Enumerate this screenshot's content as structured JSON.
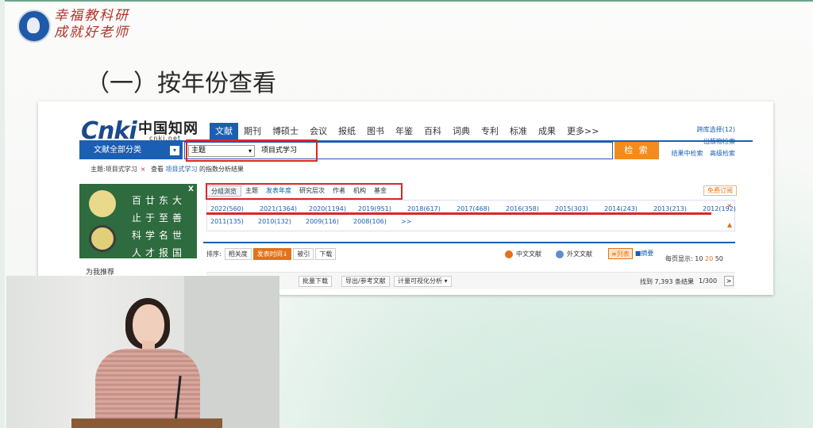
{
  "slide": {
    "logo_line1": "幸福教科研",
    "logo_line2": "成就好老师",
    "title": "（一）按年份查看"
  },
  "cnki": {
    "logo": {
      "cnki": "Cnki",
      "chinese": "中国知网",
      "net": "cnki.net"
    },
    "nav": [
      "文献",
      "期刊",
      "博硕士",
      "会议",
      "报纸",
      "图书",
      "年鉴",
      "百科",
      "词典",
      "专利",
      "标准",
      "成果",
      "更多>>"
    ],
    "right_links": {
      "cross_db": "跨库选择(12)",
      "pub_search": "出版物检索",
      "in_result": "结果中检索",
      "advanced": "高级检索"
    },
    "category_button": "文献全部分类",
    "category_dropdown": "▾",
    "search": {
      "field": "主题",
      "field_arrow": "▾",
      "query": "项目式学习",
      "button": "检 索"
    },
    "breadcrumb": {
      "tag": "主题:项目式学习",
      "close": "×",
      "view_prefix": "查看",
      "view_link": "项目式学习",
      "view_suffix": "的指数分析结果"
    },
    "ad": {
      "close": "X",
      "poem": [
        "百廿东大",
        "止于至善",
        "科学名世",
        "人才报国"
      ]
    },
    "recommend": "为我推荐",
    "group_tabs": [
      "分组浏览",
      "主题",
      "发表年度",
      "研究层次",
      "作者",
      "机构",
      "基金"
    ],
    "subscribe": "免费订阅",
    "years_row1": [
      "2022(560)",
      "2021(1364)",
      "2020(1194)",
      "2019(951)",
      "2018(617)",
      "2017(468)",
      "2016(358)",
      "2015(303)",
      "2014(243)",
      "2013(213)",
      "2012(192)"
    ],
    "years_row2": [
      "2011(135)",
      "2010(132)",
      "2009(116)",
      "2008(106)",
      ">>"
    ],
    "year_panel_close": "×",
    "year_panel_icon": "▲",
    "sort": {
      "label": "排序:",
      "options": [
        "相关度",
        "发表时间↓",
        "被引",
        "下载"
      ]
    },
    "lang": {
      "zh": "中文文献",
      "foreign": "外文文献"
    },
    "view": {
      "list": "≡列表",
      "abstract": "■摘要"
    },
    "per_page": {
      "label": "每页显示:",
      "opt1": "10",
      "opt2": "20",
      "opt3": "50"
    },
    "actions": [
      "批量下载",
      "导出/参考文献",
      "计量可视化分析 ▾"
    ],
    "found": "找到 7,393 条结果",
    "page": "1/300",
    "next": ">"
  },
  "colors": {
    "cnki_blue": "#1a5fb4",
    "search_orange": "#f28c1c",
    "highlight_red": "#e02525"
  }
}
